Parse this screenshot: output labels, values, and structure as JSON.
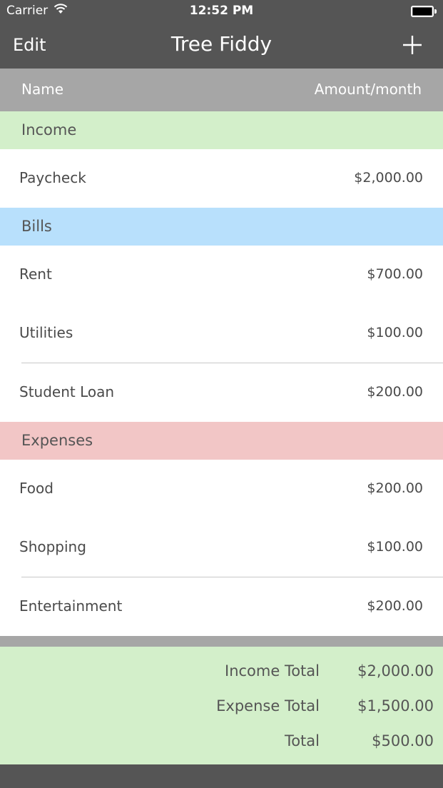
{
  "status_bar": {
    "carrier": "Carrier",
    "time": "12:52 PM"
  },
  "nav": {
    "edit_label": "Edit",
    "title": "Tree Fiddy",
    "add_icon": "plus-icon"
  },
  "columns": {
    "name": "Name",
    "amount": "Amount/month"
  },
  "sections": {
    "income": {
      "title": "Income",
      "color": "#d3efca",
      "items": [
        {
          "name": "Paycheck",
          "amount": "$2,000.00"
        }
      ]
    },
    "bills": {
      "title": "Bills",
      "color": "#b8e0fc",
      "items": [
        {
          "name": "Rent",
          "amount": "$700.00"
        },
        {
          "name": "Utilities",
          "amount": "$100.00"
        },
        {
          "name": "Student Loan",
          "amount": "$200.00"
        }
      ]
    },
    "expenses": {
      "title": "Expenses",
      "color": "#f2c6c6",
      "items": [
        {
          "name": "Food",
          "amount": "$200.00"
        },
        {
          "name": "Shopping",
          "amount": "$100.00"
        },
        {
          "name": "Entertainment",
          "amount": "$200.00"
        }
      ]
    }
  },
  "totals": {
    "income_label": "Income Total",
    "income_value": "$2,000.00",
    "expense_label": "Expense Total",
    "expense_value": "$1,500.00",
    "total_label": "Total",
    "total_value": "$500.00"
  },
  "colors": {
    "bar": "#555555",
    "header": "#a6a6a6",
    "text": "#4a4a4a"
  }
}
